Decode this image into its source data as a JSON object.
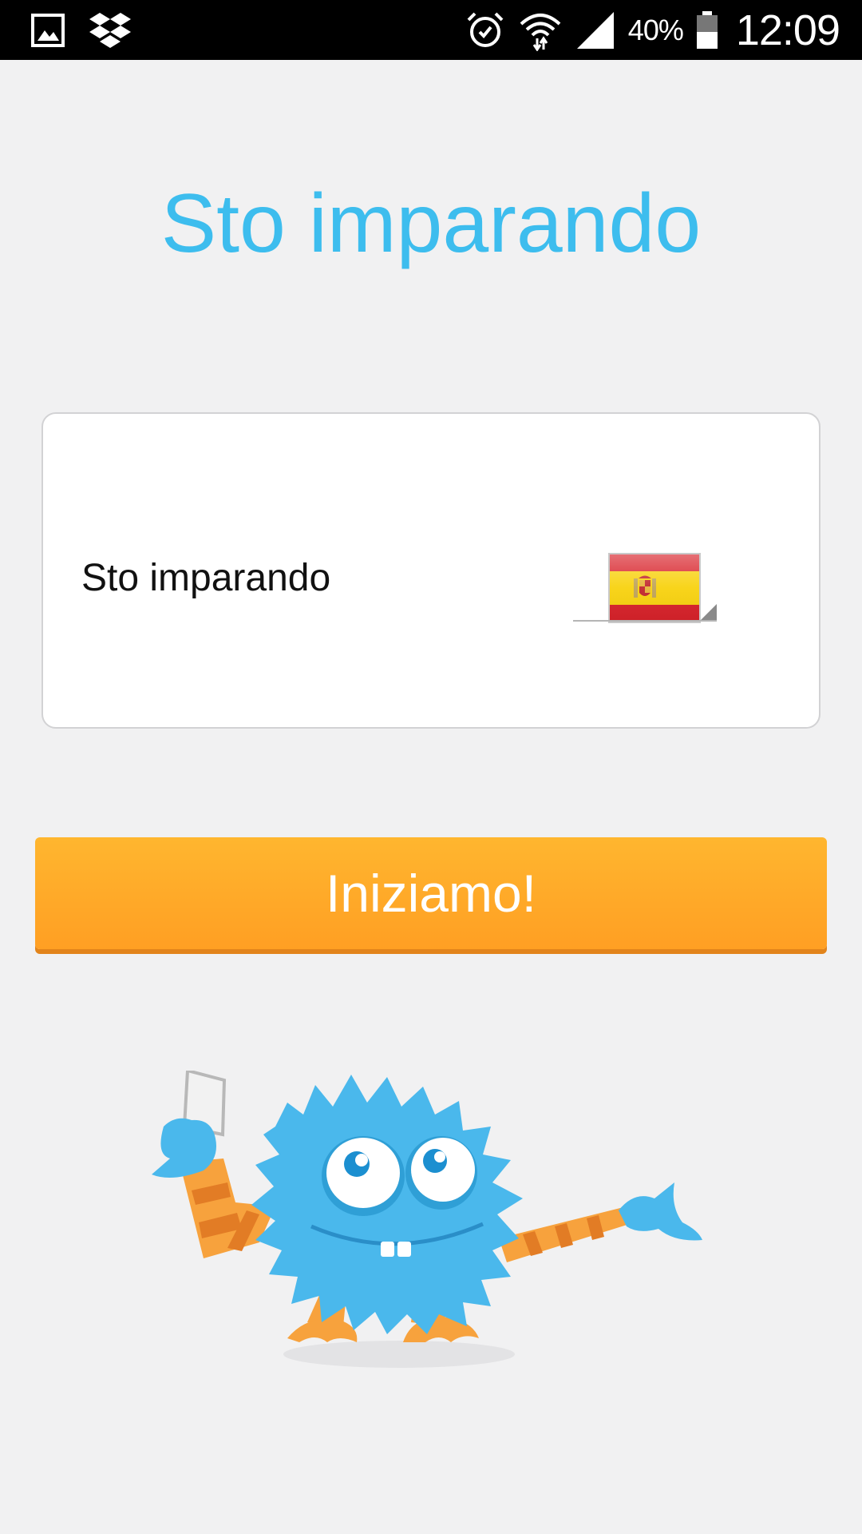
{
  "status_bar": {
    "icons": [
      "gallery-icon",
      "dropbox-icon",
      "alarm-icon",
      "wifi-icon",
      "signal-icon",
      "battery-icon"
    ],
    "battery_percent": "40%",
    "time": "12:09"
  },
  "title": "Sto imparando",
  "selector": {
    "label": "Sto imparando",
    "selected_language_icon": "spain-flag-icon"
  },
  "start_button": {
    "label": "Iniziamo!"
  },
  "colors": {
    "title": "#3dbdee",
    "button": "#ffa827",
    "mascot": "#4ab8ec",
    "background": "#f1f1f2"
  },
  "illustration": "blue-monster-mascot"
}
